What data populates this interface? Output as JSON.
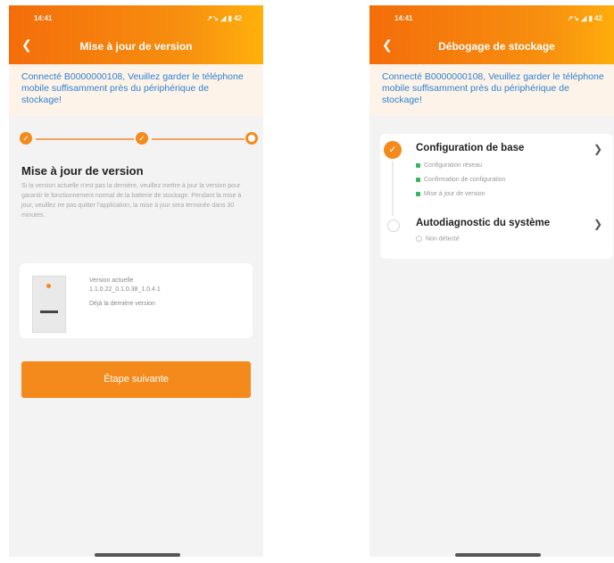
{
  "left": {
    "status": {
      "time": "14:41",
      "icons": "↗↘ ◢ ▮",
      "battery": "42"
    },
    "title": "Mise à jour de version",
    "notice": "Connecté B0000000108, Veuillez garder le téléphone mobile suffisamment près du périphérique de stockage!",
    "section_title": "Mise à jour de version",
    "description": "Si la version actuelle n'est pas la dernière, veuillez mettre à jour la version pour garantir le fonctionnement normal de la batterie de stockage. Pendant la mise à jour, veuillez ne pas quitter l'application, la mise à jour sera terminée dans 30 minutes.",
    "device": {
      "version_label": "Version actuelle",
      "version_value": "1.1.0.22_0.1.0.38_1.0.4.1",
      "latest_note": "Déjà la dernière version"
    },
    "next_button": "Étape suivante"
  },
  "right": {
    "status": {
      "time": "14:41",
      "icons": "↗↘ ◢ ▮",
      "battery": "42"
    },
    "title": "Débogage de stockage",
    "notice": "Connecté B0000000108, Veuillez garder le téléphone mobile suffisamment près du périphérique de stockage!",
    "items": [
      {
        "title": "Configuration de base",
        "subs": [
          "Configuration réseau",
          "Confirmation de configuration",
          "Mise à jour de version"
        ]
      },
      {
        "title": "Autodiagnostic du système",
        "subs": [
          "Non détecté"
        ]
      }
    ]
  },
  "colors": {
    "accent": "#f58a1c",
    "notice_text": "#2f82d2",
    "done": "#38b55d"
  }
}
